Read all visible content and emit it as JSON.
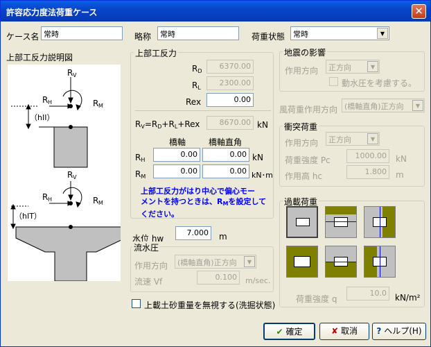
{
  "window": {
    "title": "許容応力度法荷重ケース",
    "close": "✕"
  },
  "case": {
    "name_label": "ケース名",
    "name_value": "常時",
    "abbr_label": "略称",
    "abbr_value": "常時",
    "state_label": "荷重状態",
    "state_value": "常時"
  },
  "diagram": {
    "title": "上部工反力説明図",
    "rv": "R",
    "rv_sub": "V",
    "rh": "R",
    "rh_sub": "H",
    "rm": "R",
    "rm_sub": "M",
    "hii": "（hII）",
    "hit": "（hIT）"
  },
  "reaction": {
    "group": "上部工反力",
    "rd_label": "R",
    "rd_sub": "D",
    "rd_value": "6370.00",
    "rl_label": "R",
    "rl_sub": "L",
    "rl_value": "2300.00",
    "rex_label": "Rex",
    "rex_value": "0.00",
    "rv_formula_a": "R",
    "rv_formula_a_sub": "V",
    "rv_formula_b": "=R",
    "rv_formula_b_sub": "D",
    "rv_formula_c": "+R",
    "rv_formula_c_sub": "L",
    "rv_formula_d": "+Rex",
    "rv_value": "8670.00",
    "unit_kn": "kN",
    "col_axis": "橋軸",
    "col_perp": "橋軸直角",
    "rh_label": "R",
    "rh_sub": "H",
    "rh_axis": "0.00",
    "rh_perp": "0.00",
    "rh_unit": "kN",
    "rm_label": "R",
    "rm_sub": "M",
    "rm_axis": "0.00",
    "rm_perp": "0.00",
    "rm_unit": "kN･m",
    "note_line1": "上部工反力がはり中心で偏心モー",
    "note_line2a": "メントを持つときは、R",
    "note_line2_sub": "M",
    "note_line2b": "を設定して",
    "note_line3": "ください。"
  },
  "water": {
    "level_label": "水位 hw",
    "level_value": "7.000",
    "level_unit": "m",
    "flow_group": "流水圧",
    "dir_label": "作用方向",
    "dir_value": "(橋軸直角)正方向",
    "speed_label": "流速 Vf",
    "speed_value": "0.100",
    "speed_unit": "m/sec."
  },
  "ignore_soil": {
    "label": "上載土砂重量を無視する(洗掘状態)",
    "checked": false
  },
  "seismic": {
    "group": "地震の影響",
    "dir_label": "作用方向",
    "dir_value": "正方向",
    "dyn_label": "動水圧を考慮する。"
  },
  "wind": {
    "label": "風荷重作用方向",
    "value": "(橋軸直角)正方向"
  },
  "collision": {
    "group": "衝突荷重",
    "dir_label": "作用方向",
    "dir_value": "正方向",
    "pc_label": "荷重強度  Pc",
    "pc_value": "1000.00",
    "pc_unit": "kN",
    "hc_label": "作用高  hc",
    "hc_value": "1.800",
    "hc_unit": "m"
  },
  "surcharge": {
    "group": "過載荷重",
    "q_label": "荷重強度  q",
    "q_value": "10.0",
    "q_unit": "kN/m²"
  },
  "buttons": {
    "ok": "確定",
    "cancel": "取消",
    "help": "ヘルプ(H)"
  },
  "colors": {
    "olive": "#808000",
    "gray": "#c0c0c0",
    "blue_note": "#0000ff"
  }
}
